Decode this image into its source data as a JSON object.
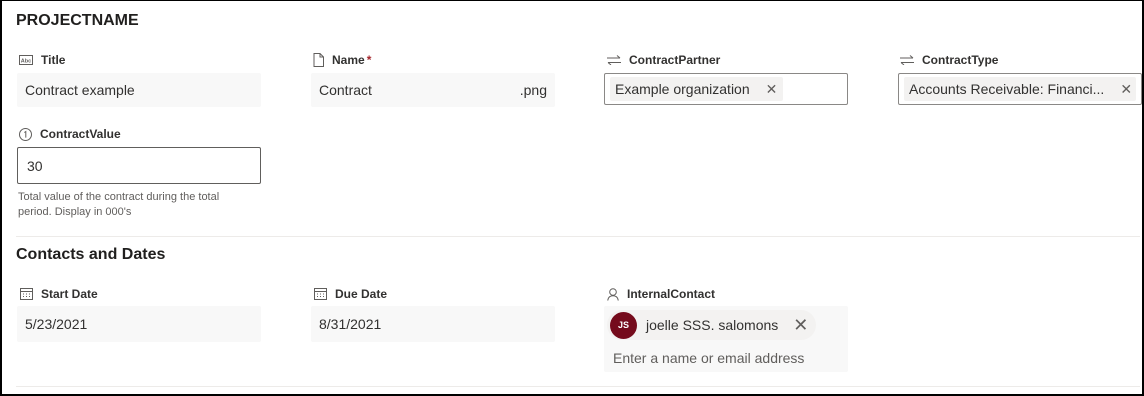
{
  "section1": {
    "title": "PROJECTNAME",
    "fields": {
      "title": {
        "label": "Title",
        "value": "Contract example",
        "icon": "text-field-icon"
      },
      "name": {
        "label": "Name",
        "required_mark": "*",
        "value": "Contract",
        "extension": ".png",
        "icon": "document-icon"
      },
      "contract_partner": {
        "label": "ContractPartner",
        "tag": "Example organization",
        "icon": "lookup-arrows-icon"
      },
      "contract_type": {
        "label": "ContractType",
        "tag": "Accounts Receivable: Financi...",
        "icon": "lookup-arrows-icon"
      },
      "contract_value": {
        "label": "ContractValue",
        "value": "30",
        "help_line1": "Total value of the contract during the total",
        "help_line2": "period. Display in 000's",
        "icon": "number-icon"
      }
    }
  },
  "section2": {
    "title": "Contacts and Dates",
    "fields": {
      "start_date": {
        "label": "Start Date",
        "value": "5/23/2021",
        "icon": "calendar-icon"
      },
      "due_date": {
        "label": "Due Date",
        "value": "8/31/2021",
        "icon": "calendar-icon"
      },
      "internal_contact": {
        "label": "InternalContact",
        "person": {
          "initials": "JS",
          "name": "joelle SSS. salomons",
          "avatar_color": "#750b1c"
        },
        "placeholder": "Enter a name or email address",
        "icon": "person-icon"
      }
    }
  },
  "colors": {
    "readonly_bg": "#f8f8f8",
    "tag_bg": "#f3f2f1",
    "required": "#a4262c",
    "avatar": "#750b1c"
  }
}
